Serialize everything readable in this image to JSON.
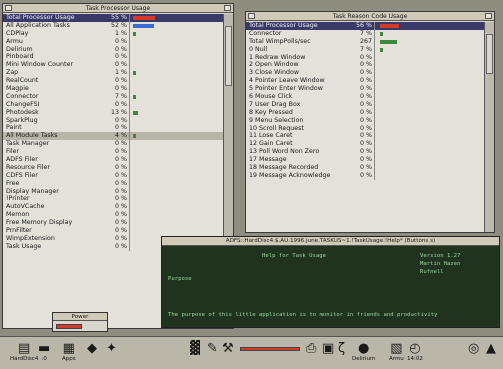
{
  "left_window": {
    "title": "Task Processor Usage",
    "header": {
      "name": "Total Processor Usage",
      "pct": "55 %",
      "value": 0.55
    },
    "rows": [
      {
        "name": "All Application Tasks",
        "pct": "52 %",
        "value": 0.52,
        "bar_color": "#3a6ad2"
      },
      {
        "name": "CDPlay",
        "pct": "1 %",
        "value": 0.01
      },
      {
        "name": "Armu",
        "pct": "0 %",
        "value": 0
      },
      {
        "name": "Delirium",
        "pct": "0 %",
        "value": 0
      },
      {
        "name": "Pinboard",
        "pct": "0 %",
        "value": 0
      },
      {
        "name": "Mini Window Counter",
        "pct": "0 %",
        "value": 0
      },
      {
        "name": "Zap",
        "pct": "1 %",
        "value": 0.01
      },
      {
        "name": "RealCount",
        "pct": "0 %",
        "value": 0
      },
      {
        "name": "Magpie",
        "pct": "0 %",
        "value": 0
      },
      {
        "name": "Connector",
        "pct": "7 %",
        "value": 0.07
      },
      {
        "name": "ChangeFSI",
        "pct": "0 %",
        "value": 0
      },
      {
        "name": "Photodesk",
        "pct": "13 %",
        "value": 0.13
      },
      {
        "name": "SparkPlug",
        "pct": "0 %",
        "value": 0
      },
      {
        "name": "Paint",
        "pct": "0 %",
        "value": 0
      },
      {
        "name": "All Module Tasks",
        "pct": "4 %",
        "value": 0.04,
        "selected": true
      },
      {
        "name": "Task Manager",
        "pct": "0 %",
        "value": 0
      },
      {
        "name": "Filer",
        "pct": "0 %",
        "value": 0
      },
      {
        "name": "ADFS Filer",
        "pct": "0 %",
        "value": 0
      },
      {
        "name": "Resource Filer",
        "pct": "0 %",
        "value": 0
      },
      {
        "name": "CDFS Filer",
        "pct": "0 %",
        "value": 0
      },
      {
        "name": "Free",
        "pct": "0 %",
        "value": 0
      },
      {
        "name": "Display Manager",
        "pct": "0 %",
        "value": 0
      },
      {
        "name": "!Printer",
        "pct": "0 %",
        "value": 0
      },
      {
        "name": "AutoVCache",
        "pct": "0 %",
        "value": 0
      },
      {
        "name": "Memon",
        "pct": "0 %",
        "value": 0
      },
      {
        "name": "Free Memory Display",
        "pct": "0 %",
        "value": 0
      },
      {
        "name": "PrnFilter",
        "pct": "0 %",
        "value": 0
      },
      {
        "name": "WimpExtension",
        "pct": "0 %",
        "value": 0
      },
      {
        "name": "Task Usage",
        "pct": "0 %",
        "value": 0
      }
    ]
  },
  "right_window": {
    "title": "Task Reason Code Usage",
    "header": {
      "name": "Total Processor Usage",
      "pct": "56 %",
      "value": 0.56
    },
    "rows": [
      {
        "name": "Connector",
        "pct": "7 %",
        "value": 0.07
      },
      {
        "name": "Total WimpPolls/sec",
        "pct": "267",
        "value": 0.5
      },
      {
        "name": "0 Null",
        "pct": "7 %",
        "value": 0.07
      },
      {
        "name": "1 Redraw Window",
        "pct": "0 %",
        "value": 0
      },
      {
        "name": "2 Open Window",
        "pct": "0 %",
        "value": 0
      },
      {
        "name": "3 Close Window",
        "pct": "0 %",
        "value": 0
      },
      {
        "name": "4 Pointer Leave Window",
        "pct": "0 %",
        "value": 0
      },
      {
        "name": "5 Pointer Enter Window",
        "pct": "0 %",
        "value": 0
      },
      {
        "name": "6 Mouse Click",
        "pct": "0 %",
        "value": 0
      },
      {
        "name": "7 User Drag Box",
        "pct": "0 %",
        "value": 0
      },
      {
        "name": "8 Key Pressed",
        "pct": "0 %",
        "value": 0
      },
      {
        "name": "9 Menu Selection",
        "pct": "0 %",
        "value": 0
      },
      {
        "name": "10 Scroll Request",
        "pct": "0 %",
        "value": 0
      },
      {
        "name": "11 Lose Caret",
        "pct": "0 %",
        "value": 0
      },
      {
        "name": "12 Gain Caret",
        "pct": "0 %",
        "value": 0
      },
      {
        "name": "13 Poll Word Non Zero",
        "pct": "0 %",
        "value": 0
      },
      {
        "name": "17 Message",
        "pct": "0 %",
        "value": 0
      },
      {
        "name": "18 Message Recorded",
        "pct": "0 %",
        "value": 0
      },
      {
        "name": "19 Message Acknowledge",
        "pct": "0 %",
        "value": 0
      }
    ]
  },
  "help_window": {
    "title": "ADFS::HardDisc4.$.AU.1996.june.TASKUS~1.!TaskUsage.!Help* (Buttons s)",
    "lines": {
      "heading": "Help for Task Usage",
      "version": "Version 1.27",
      "author1": "Martin Hazen",
      "author2": "Rufnell",
      "section": "Purpose",
      "body": "The purpose of this little application is to monitor in friends and productivity"
    }
  },
  "power_window": {
    "label": "Power"
  },
  "iconbar": {
    "left": [
      {
        "icon": "harddisc-icon",
        "label": "HardDisc4"
      },
      {
        "icon": "floppy-icon",
        "label": ":0"
      },
      {
        "icon": "apps-icon",
        "label": "Apps"
      },
      {
        "icon": "diamond-icon",
        "label": ""
      },
      {
        "icon": "network-icon",
        "label": ""
      }
    ],
    "right": [
      {
        "icon": "task-usage-icon",
        "label": ""
      },
      {
        "icon": "paint-icon",
        "label": ""
      },
      {
        "icon": "tools-icon",
        "label": ""
      },
      {
        "icon": "memory-bar-icon",
        "label": ""
      },
      {
        "icon": "printer-icon",
        "label": ""
      },
      {
        "icon": "display-icon",
        "label": ""
      },
      {
        "icon": "zap-icon",
        "label": ""
      },
      {
        "icon": "delirium-icon",
        "label": "Delirium"
      },
      {
        "icon": "armu-icon",
        "label": "Armu"
      },
      {
        "icon": "clock-icon",
        "label": "14:02"
      },
      {
        "icon": "cd-icon",
        "label": ""
      },
      {
        "icon": "task-manager-icon",
        "label": ""
      }
    ]
  },
  "colors": {
    "desktop": "#8f8d80",
    "bar_green": "#3a8a3a",
    "bar_red": "#d23a2a",
    "bar_blue": "#3a6ad2"
  }
}
